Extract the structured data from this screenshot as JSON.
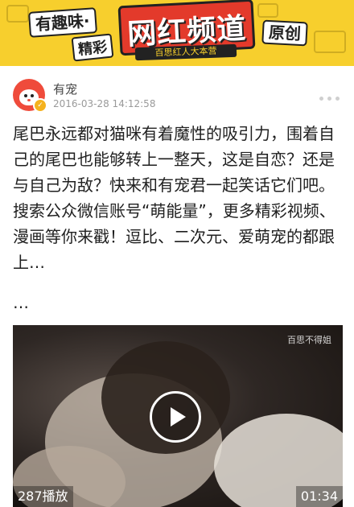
{
  "banner": {
    "title": "网红频道",
    "tag_left": "有趣味·",
    "tag_small": "精彩",
    "tag_right": "原创",
    "subtitle": "百思红人大本营",
    "background_color": "#f7cf2d",
    "accent_color": "#e33a2b"
  },
  "post": {
    "author": "有宠",
    "timestamp": "2016-03-28 14:12:58",
    "avatar_icon": "cat-face-avatar-icon",
    "verified_icon": "verified-badge-icon",
    "more_icon": "more-dots-icon",
    "text": "尾巴永远都对猫咪有着魔性的吸引力，围着自己的尾巴也能够转上一整天，这是自恋？还是与自己为敌？快来和有宠君一起笑话它们吧。搜索公众微信账号“萌能量”，更多精彩视频、漫画等你来戳！逗比、二次元、爱萌宠的都跟上…",
    "ellipsis": "…"
  },
  "video": {
    "watermark": "百思不得姐",
    "play_icon": "play-icon",
    "play_count": "287播放",
    "duration": "01:34"
  }
}
